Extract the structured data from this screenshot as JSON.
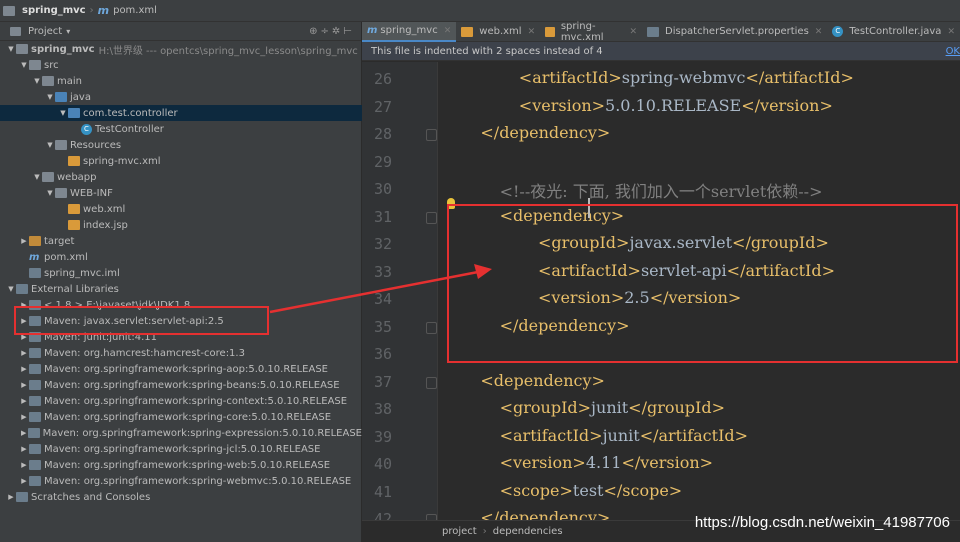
{
  "breadcrumb": {
    "project": "spring_mvc",
    "file": "pom.xml"
  },
  "project_panel": {
    "title": "Project",
    "tree": [
      {
        "label": "spring_mvc",
        "note": "H:\\世界级 --- opentcs\\spring_mvc_lesson\\spring_mvc",
        "icon": "folder-icon",
        "arrow": "▼"
      },
      {
        "label": "src",
        "icon": "folder-icon",
        "arrow": "▼"
      },
      {
        "label": "main",
        "icon": "folder-icon",
        "arrow": "▼"
      },
      {
        "label": "java",
        "icon": "source-folder-icon",
        "arrow": "▼"
      },
      {
        "label": "com.test.controller",
        "icon": "package-icon",
        "arrow": "▼"
      },
      {
        "label": "TestController",
        "icon": "class-icon",
        "arrow": ""
      },
      {
        "label": "Resources",
        "icon": "resources-folder-icon",
        "arrow": "▼"
      },
      {
        "label": "spring-mvc.xml",
        "icon": "xml-file-icon",
        "arrow": ""
      },
      {
        "label": "webapp",
        "icon": "folder-icon",
        "arrow": "▼"
      },
      {
        "label": "WEB-INF",
        "icon": "folder-icon",
        "arrow": "▼"
      },
      {
        "label": "web.xml",
        "icon": "xml-file-icon",
        "arrow": ""
      },
      {
        "label": "index.jsp",
        "icon": "jsp-file-icon",
        "arrow": ""
      },
      {
        "label": "target",
        "icon": "excluded-folder-icon",
        "arrow": "▶"
      },
      {
        "label": "pom.xml",
        "icon": "maven-icon",
        "arrow": ""
      },
      {
        "label": "spring_mvc.iml",
        "icon": "iml-file-icon",
        "arrow": ""
      },
      {
        "label": "External Libraries",
        "icon": "libraries-icon",
        "arrow": "▼"
      },
      {
        "label": "< 1.8 > E:\\javaset\\jdk\\JDK1.8",
        "icon": "jdk-icon",
        "arrow": "▶"
      },
      {
        "label": "Maven: javax.servlet:servlet-api:2.5",
        "icon": "library-icon",
        "arrow": "▶"
      },
      {
        "label": "Maven: junit:junit:4.11",
        "icon": "library-icon",
        "arrow": "▶"
      },
      {
        "label": "Maven: org.hamcrest:hamcrest-core:1.3",
        "icon": "library-icon",
        "arrow": "▶"
      },
      {
        "label": "Maven: org.springframework:spring-aop:5.0.10.RELEASE",
        "icon": "library-icon",
        "arrow": "▶"
      },
      {
        "label": "Maven: org.springframework:spring-beans:5.0.10.RELEASE",
        "icon": "library-icon",
        "arrow": "▶"
      },
      {
        "label": "Maven: org.springframework:spring-context:5.0.10.RELEASE",
        "icon": "library-icon",
        "arrow": "▶"
      },
      {
        "label": "Maven: org.springframework:spring-core:5.0.10.RELEASE",
        "icon": "library-icon",
        "arrow": "▶"
      },
      {
        "label": "Maven: org.springframework:spring-expression:5.0.10.RELEASE",
        "icon": "library-icon",
        "arrow": "▶"
      },
      {
        "label": "Maven: org.springframework:spring-jcl:5.0.10.RELEASE",
        "icon": "library-icon",
        "arrow": "▶"
      },
      {
        "label": "Maven: org.springframework:spring-web:5.0.10.RELEASE",
        "icon": "library-icon",
        "arrow": "▶"
      },
      {
        "label": "Maven: org.springframework:spring-webmvc:5.0.10.RELEASE",
        "icon": "library-icon",
        "arrow": "▶"
      },
      {
        "label": "Scratches and Consoles",
        "icon": "scratches-icon",
        "arrow": "▶"
      }
    ]
  },
  "tabs": [
    {
      "label": "spring_mvc",
      "active": true,
      "icon": "maven-icon"
    },
    {
      "label": "web.xml",
      "active": false,
      "icon": "xml-file-icon"
    },
    {
      "label": "spring-mvc.xml",
      "active": false,
      "icon": "xml-file-icon"
    },
    {
      "label": "DispatcherServlet.properties",
      "active": false,
      "icon": "properties-file-icon"
    },
    {
      "label": "TestController.java",
      "active": false,
      "icon": "class-icon"
    }
  ],
  "banner": {
    "text": "This file is indented with 2 spaces instead of 4",
    "ok": "OK"
  },
  "editor": {
    "lines": [
      {
        "n": "26",
        "indent": 4,
        "open": "artifactId",
        "text": "spring-webmvc"
      },
      {
        "n": "27",
        "indent": 4,
        "open": "version",
        "text": "5.0.10.RELEASE"
      },
      {
        "n": "28",
        "indent": 2,
        "close": "dependency"
      },
      {
        "n": "29"
      },
      {
        "n": "30",
        "indent": 3,
        "comment": "<!--夜光: 下面, 我们加入一个servlet依赖-->"
      },
      {
        "n": "31",
        "indent": 3,
        "open_only": "dependency"
      },
      {
        "n": "32",
        "indent": 5,
        "open": "groupId",
        "text": "javax.servlet"
      },
      {
        "n": "33",
        "indent": 5,
        "open": "artifactId",
        "text": "servlet-api"
      },
      {
        "n": "34",
        "indent": 5,
        "open": "version",
        "text": "2.5"
      },
      {
        "n": "35",
        "indent": 3,
        "close": "dependency"
      },
      {
        "n": "36"
      },
      {
        "n": "37",
        "indent": 2,
        "open_only": "dependency"
      },
      {
        "n": "38",
        "indent": 3,
        "open": "groupId",
        "text": "junit"
      },
      {
        "n": "39",
        "indent": 3,
        "open": "artifactId",
        "text": "junit"
      },
      {
        "n": "40",
        "indent": 3,
        "open": "version",
        "text": "4.11"
      },
      {
        "n": "41",
        "indent": 3,
        "open": "scope",
        "text": "test"
      },
      {
        "n": "42",
        "indent": 2,
        "close": "dependency"
      }
    ]
  },
  "status_bar": {
    "crumbs": [
      "project",
      "dependencies"
    ]
  },
  "watermark": "https://blog.csdn.net/weixin_41987706",
  "colors": {
    "annotation": "#e53030",
    "tag": "#e8bf6a",
    "comment": "#808080",
    "background": "#2b2b2b"
  }
}
